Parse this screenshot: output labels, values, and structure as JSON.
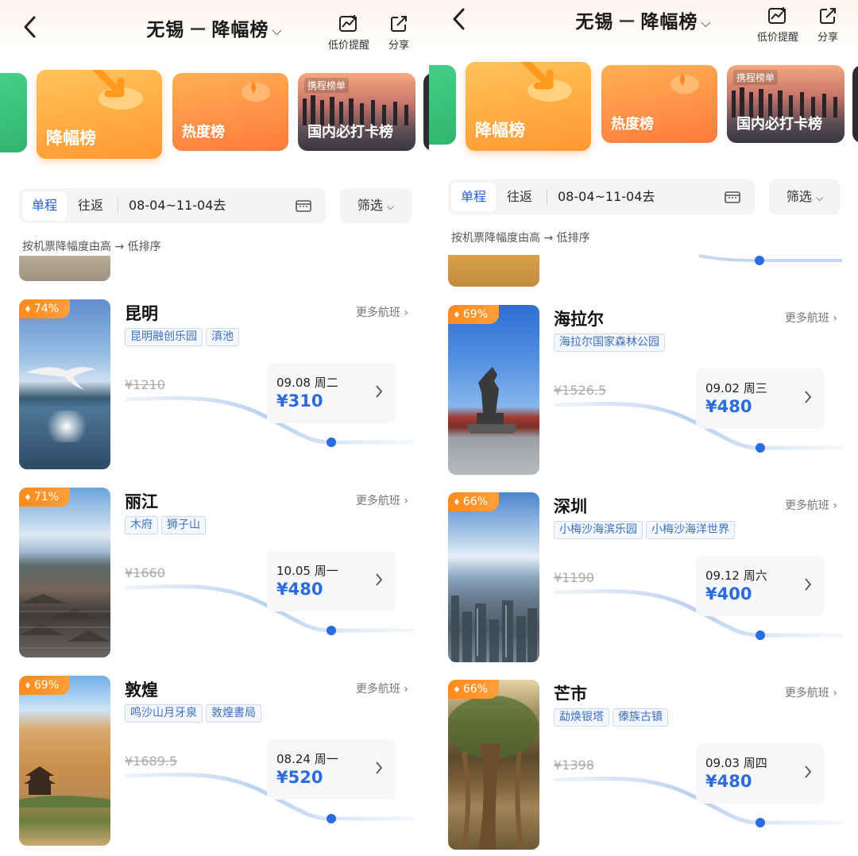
{
  "screens": [
    {
      "header": {
        "origin": "无锡",
        "title": "降幅榜",
        "alert_label": "低价提醒",
        "share_label": "分享"
      },
      "categories": [
        {
          "label": "降幅榜"
        },
        {
          "label": "热度榜"
        },
        {
          "label": "国内必打卡榜",
          "badge": "携程榜单"
        }
      ],
      "filter": {
        "oneway": "单程",
        "round": "往返",
        "dates": "08-04~11-04去",
        "filter_label": "筛选"
      },
      "sort_note": "按机票降幅度由高 → 低排序",
      "destinations": [
        {
          "pct": "74%",
          "city": "昆明",
          "more": "更多航班",
          "tags": [
            "昆明融创乐园",
            "滇池"
          ],
          "orig": "¥1210",
          "date": "09.08 周二",
          "price": "¥310"
        },
        {
          "pct": "71%",
          "city": "丽江",
          "more": "更多航班",
          "tags": [
            "木府",
            "狮子山"
          ],
          "orig": "¥1660",
          "date": "10.05 周一",
          "price": "¥480"
        },
        {
          "pct": "69%",
          "city": "敦煌",
          "more": "更多航班",
          "tags": [
            "鸣沙山月牙泉",
            "敦煌書局"
          ],
          "orig": "¥1689.5",
          "date": "08.24 周一",
          "price": "¥520"
        }
      ]
    },
    {
      "header": {
        "origin": "无锡",
        "title": "降幅榜",
        "alert_label": "低价提醒",
        "share_label": "分享"
      },
      "categories": [
        {
          "label": "降幅榜"
        },
        {
          "label": "热度榜"
        },
        {
          "label": "国内必打卡榜",
          "badge": "携程榜单"
        }
      ],
      "filter": {
        "oneway": "单程",
        "round": "往返",
        "dates": "08-04~11-04去",
        "filter_label": "筛选"
      },
      "sort_note": "按机票降幅度由高 → 低排序",
      "destinations": [
        {
          "pct": "69%",
          "city": "海拉尔",
          "more": "更多航班",
          "tags": [
            "海拉尔国家森林公园"
          ],
          "orig": "¥1526.5",
          "date": "09.02 周三",
          "price": "¥480"
        },
        {
          "pct": "66%",
          "city": "深圳",
          "more": "更多航班",
          "tags": [
            "小梅沙海滨乐园",
            "小梅沙海洋世界"
          ],
          "orig": "¥1190",
          "date": "09.12 周六",
          "price": "¥400"
        },
        {
          "pct": "66%",
          "city": "芒市",
          "more": "更多航班",
          "tags": [
            "勐焕银塔",
            "傣族古镇"
          ],
          "orig": "¥1398",
          "date": "09.03 周四",
          "price": "¥480"
        }
      ]
    }
  ]
}
